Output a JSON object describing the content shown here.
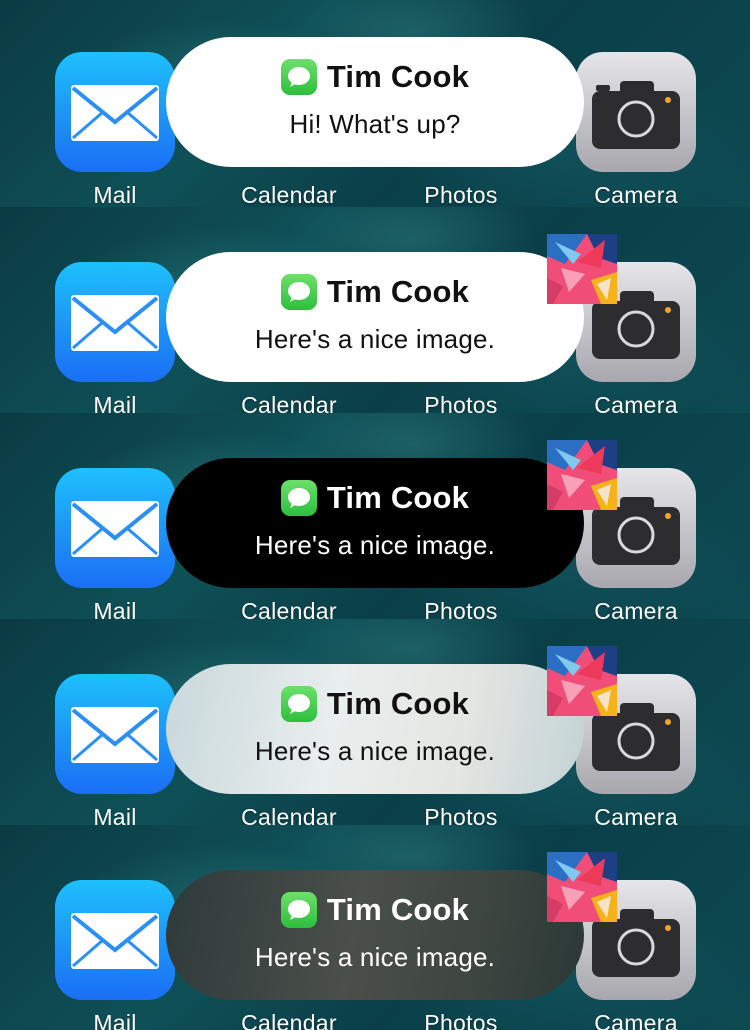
{
  "home_screen": {
    "apps": [
      {
        "label": "Mail",
        "icon": "mail-icon"
      },
      {
        "label": "Calendar",
        "icon": "calendar-icon"
      },
      {
        "label": "Photos",
        "icon": "photos-icon"
      },
      {
        "label": "Camera",
        "icon": "camera-icon"
      }
    ]
  },
  "notifications": [
    {
      "style": "light",
      "app_icon": "messages-icon",
      "sender": "Tim Cook",
      "message": "Hi! What's up?",
      "has_thumbnail": false
    },
    {
      "style": "light",
      "app_icon": "messages-icon",
      "sender": "Tim Cook",
      "message": "Here's a nice image.",
      "has_thumbnail": true
    },
    {
      "style": "dark",
      "app_icon": "messages-icon",
      "sender": "Tim Cook",
      "message": "Here's a nice image.",
      "has_thumbnail": true
    },
    {
      "style": "frosted-light",
      "app_icon": "messages-icon",
      "sender": "Tim Cook",
      "message": "Here's a nice image.",
      "has_thumbnail": true
    },
    {
      "style": "frosted-dark",
      "app_icon": "messages-icon",
      "sender": "Tim Cook",
      "message": "Here's a nice image.",
      "has_thumbnail": true
    }
  ],
  "colors": {
    "wallpaper": "#0a3c45",
    "mail_icon_top": "#1ec0fc",
    "mail_icon_bottom": "#1b6ef5",
    "messages_green": "#2dbf3e",
    "camera_icon": "#c8c8cc",
    "light_bubble": "#ffffff",
    "dark_bubble": "#000000"
  }
}
